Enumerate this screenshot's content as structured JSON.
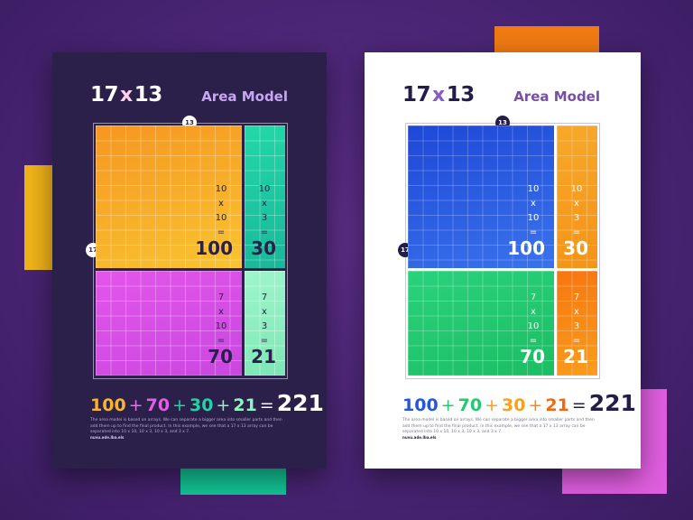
{
  "posters": [
    {
      "theme": "dark",
      "heading": {
        "num_a": "17",
        "times": "x",
        "num_b": "13",
        "label": "Area Model"
      },
      "dim_top": "13",
      "dim_left": "17",
      "cells": [
        {
          "a": "10",
          "op": "x",
          "b": "10",
          "eq": "=",
          "result": "100",
          "color": "#f5a623"
        },
        {
          "a": "10",
          "op": "x",
          "b": "3",
          "eq": "=",
          "result": "30",
          "color": "#1fd3a5"
        },
        {
          "a": "7",
          "op": "x",
          "b": "10",
          "eq": "=",
          "result": "70",
          "color": "#e04ee6"
        },
        {
          "a": "7",
          "op": "x",
          "b": "3",
          "eq": "=",
          "result": "21",
          "color": "#8ff2c1"
        }
      ],
      "sum": {
        "t1": "100",
        "p1": "+",
        "t2": "70",
        "p2": "+",
        "t3": "30",
        "p3": "+",
        "t4": "21",
        "eq": "=",
        "total": "221"
      },
      "description": "The area model is based on arrays. We can separate a bigger area into smaller parts and then add them up to find the final product. In this example, we see that a 17 x 13 array can be separated into 10 x 10, 10 x 3, 10 x 3, and 3 x 7.",
      "credit": "nuvu.ade.lba.els"
    },
    {
      "theme": "light",
      "heading": {
        "num_a": "17",
        "times": "x",
        "num_b": "13",
        "label": "Area Model"
      },
      "dim_top": "13",
      "dim_left": "17",
      "cells": [
        {
          "a": "10",
          "op": "x",
          "b": "10",
          "eq": "=",
          "result": "100",
          "color": "#2456e0"
        },
        {
          "a": "10",
          "op": "x",
          "b": "3",
          "eq": "=",
          "result": "30",
          "color": "#f7a121"
        },
        {
          "a": "7",
          "op": "x",
          "b": "10",
          "eq": "=",
          "result": "70",
          "color": "#22c96f"
        },
        {
          "a": "7",
          "op": "x",
          "b": "3",
          "eq": "=",
          "result": "21",
          "color": "#f88a12"
        }
      ],
      "sum": {
        "t1": "100",
        "p1": "+",
        "t2": "70",
        "p2": "+",
        "t3": "30",
        "p3": "+",
        "t4": "21",
        "eq": "=",
        "total": "221"
      },
      "description": "The area model is based on arrays. We can separate a bigger area into smaller parts and then add them up to find the final product. In this example, we see that a 17 x 13 array can be separated into 10 x 10, 10 x 3, 10 x 3, and 3 x 7.",
      "credit": "nuvu.ade.lba.els"
    }
  ],
  "colors": {
    "background": "#4a2575",
    "dark_poster": "#2a2049",
    "light_poster": "#ffffff",
    "accent_purple": "#7a4ea3",
    "deco_orange": "#f07a12",
    "deco_yellow": "#f0b419",
    "deco_teal": "#14c496",
    "deco_pink": "#e05ee0"
  }
}
